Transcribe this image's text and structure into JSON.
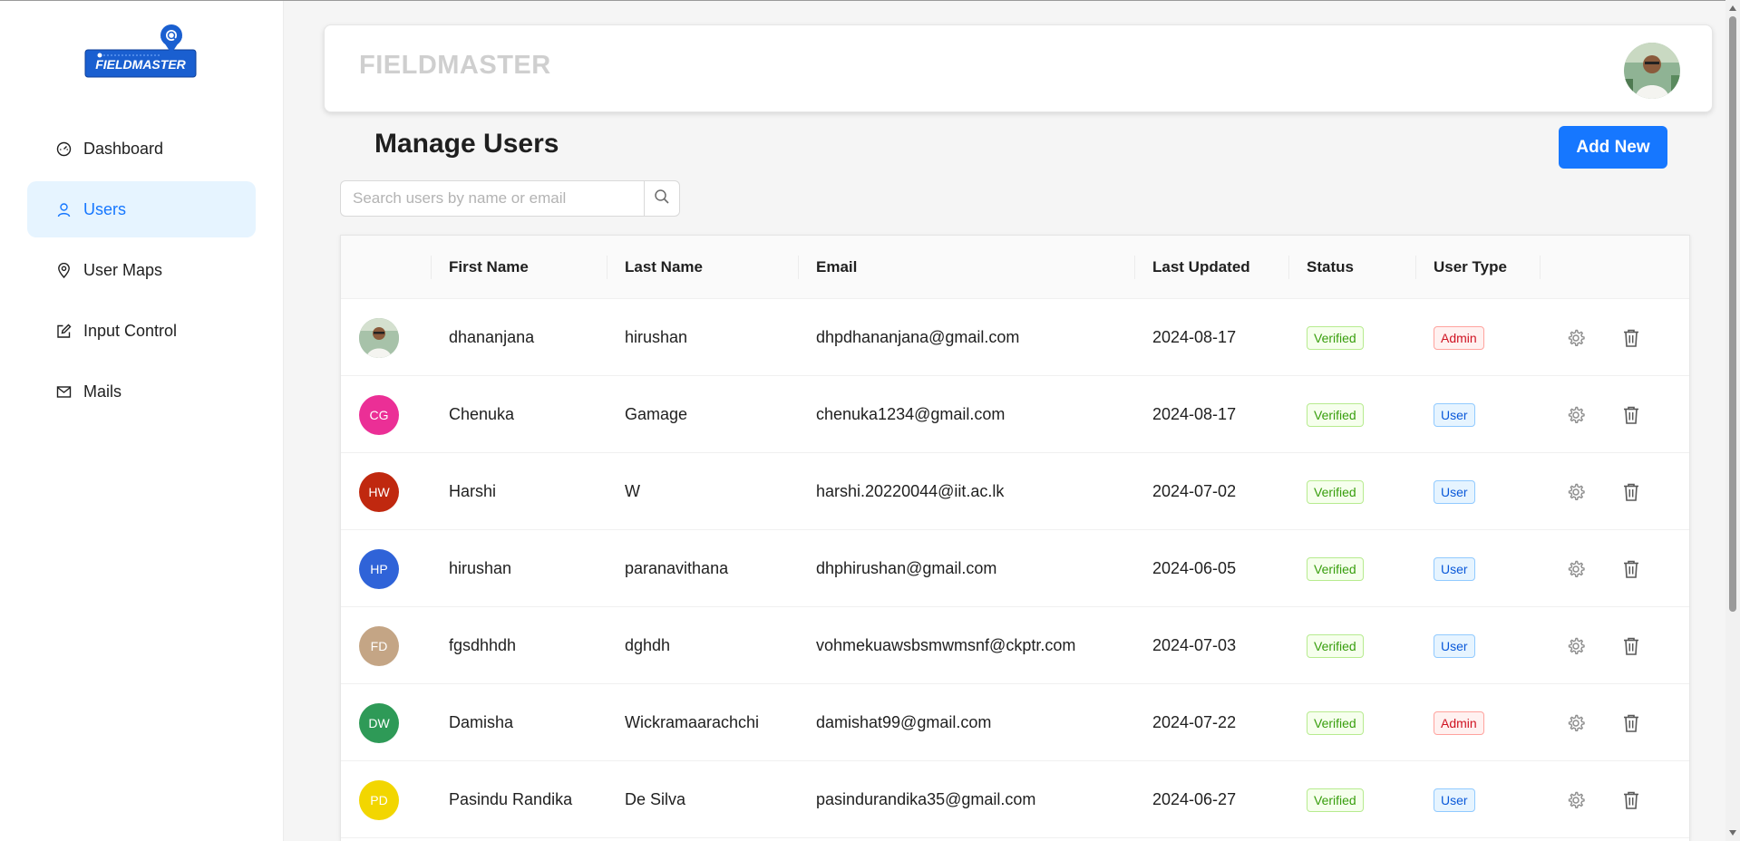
{
  "app": {
    "brand": "FIELDMASTER",
    "logo_text": "FIELDMASTER"
  },
  "sidebar": {
    "items": [
      {
        "label": "Dashboard",
        "icon": "dashboard-icon",
        "active": false
      },
      {
        "label": "Users",
        "icon": "user-icon",
        "active": true
      },
      {
        "label": "User Maps",
        "icon": "map-pin-icon",
        "active": false
      },
      {
        "label": "Input Control",
        "icon": "edit-icon",
        "active": false
      },
      {
        "label": "Mails",
        "icon": "mail-icon",
        "active": false
      }
    ]
  },
  "header": {
    "title": "FIELDMASTER"
  },
  "page": {
    "title": "Manage Users",
    "add_button": "Add New",
    "search_placeholder": "Search users by name or email"
  },
  "table": {
    "columns": [
      "First Name",
      "Last Name",
      "Email",
      "Last Updated",
      "Status",
      "User Type"
    ],
    "rows": [
      {
        "initials": "",
        "photo": true,
        "avatar_color": "#9bb7a0",
        "first": "dhananjana",
        "last": "hirushan",
        "email": "dhpdhananjana@gmail.com",
        "updated": "2024-08-17",
        "status": "Verified",
        "type": "Admin"
      },
      {
        "initials": "CG",
        "photo": false,
        "avatar_color": "#eb2f96",
        "first": "Chenuka",
        "last": "Gamage",
        "email": "chenuka1234@gmail.com",
        "updated": "2024-08-17",
        "status": "Verified",
        "type": "User"
      },
      {
        "initials": "HW",
        "photo": false,
        "avatar_color": "#c0280f",
        "first": "Harshi",
        "last": "W",
        "email": "harshi.20220044@iit.ac.lk",
        "updated": "2024-07-02",
        "status": "Verified",
        "type": "User"
      },
      {
        "initials": "HP",
        "photo": false,
        "avatar_color": "#2f63d8",
        "first": "hirushan",
        "last": "paranavithana",
        "email": "dhphirushan@gmail.com",
        "updated": "2024-06-05",
        "status": "Verified",
        "type": "User"
      },
      {
        "initials": "FD",
        "photo": false,
        "avatar_color": "#c4a585",
        "first": "fgsdhhdh",
        "last": "dghdh",
        "email": "vohmekuawsbsmwmsnf@ckptr.com",
        "updated": "2024-07-03",
        "status": "Verified",
        "type": "User"
      },
      {
        "initials": "DW",
        "photo": false,
        "avatar_color": "#2e9a57",
        "first": "Damisha",
        "last": "Wickramaarachchi",
        "email": "damishat99@gmail.com",
        "updated": "2024-07-22",
        "status": "Verified",
        "type": "Admin"
      },
      {
        "initials": "PD",
        "photo": false,
        "avatar_color": "#f2d600",
        "first": "Pasindu Randika",
        "last": "De Silva",
        "email": "pasindurandika35@gmail.com",
        "updated": "2024-06-27",
        "status": "Verified",
        "type": "User"
      }
    ]
  },
  "colors": {
    "accent": "#1677ff",
    "active_bg": "#e6f4ff"
  }
}
